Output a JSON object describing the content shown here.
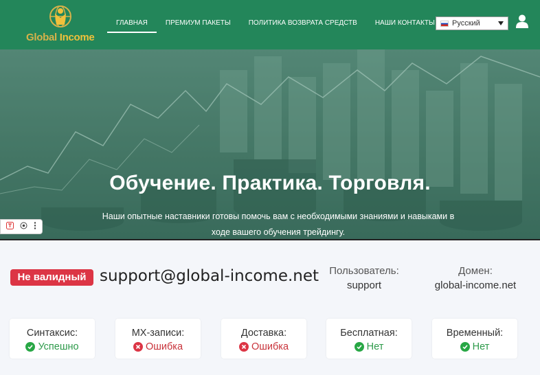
{
  "site": {
    "logo": {
      "part1": "Global",
      "part2": "Income"
    },
    "nav": [
      {
        "label": "ГЛАВНАЯ",
        "active": true
      },
      {
        "label": "ПРЕМИУМ ПАКЕТЫ",
        "active": false
      },
      {
        "label": "ПОЛИТИКА ВОЗВРАТА СРЕДСТВ",
        "active": false
      },
      {
        "label": "НАШИ КОНТАКТЫ",
        "active": false
      }
    ],
    "language": {
      "selected": "Русский"
    },
    "hero": {
      "title": "Обучение. Практика. Торговля.",
      "subtitle": "Наши опытные наставники готовы помочь вам с необходимыми знаниями и навыками в ходе вашего обучения трейдингу."
    },
    "colors": {
      "navbar": "#23865a",
      "logo_gold": "#f0c13b"
    }
  },
  "result": {
    "status_badge": "Не валидный",
    "email": "support@global-income.net",
    "user_label": "Пользователь:",
    "user_value": "support",
    "domain_label": "Домен:",
    "domain_value": "global-income.net",
    "checks": [
      {
        "label": "Синтаксис:",
        "value": "Успешно",
        "status": "ok"
      },
      {
        "label": "MX-записи:",
        "value": "Ошибка",
        "status": "err"
      },
      {
        "label": "Доставка:",
        "value": "Ошибка",
        "status": "err"
      },
      {
        "label": "Бесплатная:",
        "value": "Нет",
        "status": "ok"
      },
      {
        "label": "Временный:",
        "value": "Нет",
        "status": "ok"
      }
    ],
    "colors": {
      "invalid": "#dc3545",
      "ok": "#28a745"
    }
  }
}
